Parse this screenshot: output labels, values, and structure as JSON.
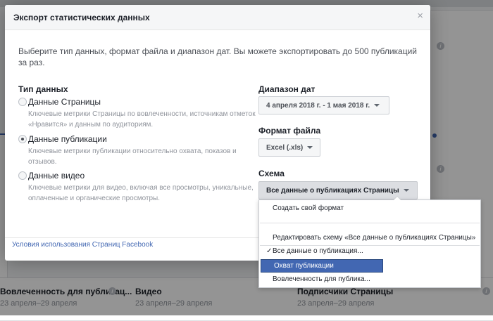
{
  "background": {
    "cards": [
      {
        "title": "Вовлеченность для публикац...",
        "date": "23 апреля–29 апреля"
      },
      {
        "title": "Видео",
        "date": "23 апреля–29 апреля"
      },
      {
        "title": "Подписчики Страницы",
        "date": "23 апреля–29 апреля"
      }
    ]
  },
  "dialog": {
    "title": "Экспорт статистических данных",
    "close_glyph": "×",
    "intro": "Выберите тип данных, формат файла и диапазон дат. Вы можете экспортировать до 500 публикаций за раз.",
    "data_type": {
      "label": "Тип данных",
      "options": [
        {
          "label": "Данные Страницы",
          "desc": "Ключевые метрики Страницы по вовлеченности, источникам отметок «Нравится» и данным по аудиториям.",
          "checked": false
        },
        {
          "label": "Данные публикации",
          "desc": "Ключевые метрики публикации относительно охвата, показов и отзывов.",
          "checked": true
        },
        {
          "label": "Данные видео",
          "desc": "Ключевые метрики для видео, включая все просмотры, уникальные, оплаченные и органические просмотры.",
          "checked": false
        }
      ]
    },
    "date_range": {
      "label": "Диапазон дат",
      "value": "4 апреля 2018 г. - 1 мая 2018 г."
    },
    "file_format": {
      "label": "Формат файла",
      "value": "Excel (.xls)"
    },
    "schema": {
      "label": "Схема",
      "value": "Все данные о публикациях Страницы"
    },
    "footer_link": "Условия использования Страниц Facebook"
  },
  "dropdown": {
    "create": "Создать свой формат",
    "edit": "Редактировать схему «Все данные о публикациях Страницы»",
    "checkmark": "✓",
    "items": [
      {
        "label": "Все данные о публикация...",
        "checked": true,
        "active": false
      },
      {
        "label": "Охват публикации",
        "checked": false,
        "active": true
      },
      {
        "label": "Вовлеченность для публика...",
        "checked": false,
        "active": false
      }
    ]
  }
}
